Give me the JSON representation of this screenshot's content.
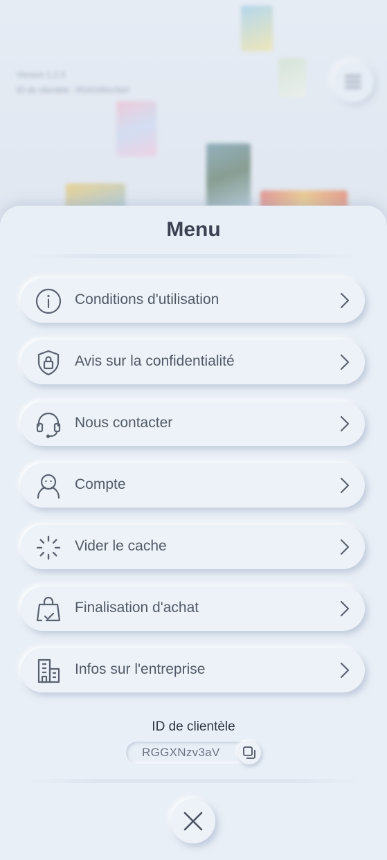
{
  "background": {
    "version_text": "Version 1.2.3",
    "customer_id_text": "ID de clientèle : RGGXNzv3aV"
  },
  "menu": {
    "title": "Menu",
    "items": [
      {
        "label": "Conditions d'utilisation",
        "icon": "info-icon"
      },
      {
        "label": "Avis sur la confidentialité",
        "icon": "shield-lock-icon"
      },
      {
        "label": "Nous contacter",
        "icon": "headset-icon"
      },
      {
        "label": "Compte",
        "icon": "user-icon"
      },
      {
        "label": "Vider le cache",
        "icon": "loading-spinner-icon"
      },
      {
        "label": "Finalisation d'achat",
        "icon": "shopping-bag-check-icon"
      },
      {
        "label": "Infos sur l'entreprise",
        "icon": "building-icon"
      }
    ]
  },
  "customer": {
    "label": "ID de clientèle",
    "id": "RGGXNzv3aV"
  },
  "colors": {
    "background": "#dfe7f1",
    "sheet": "#e9eff6",
    "button": "#edf2f8",
    "text_primary": "#3a4150",
    "text_item": "#525a67",
    "icon": "#5a6270"
  }
}
